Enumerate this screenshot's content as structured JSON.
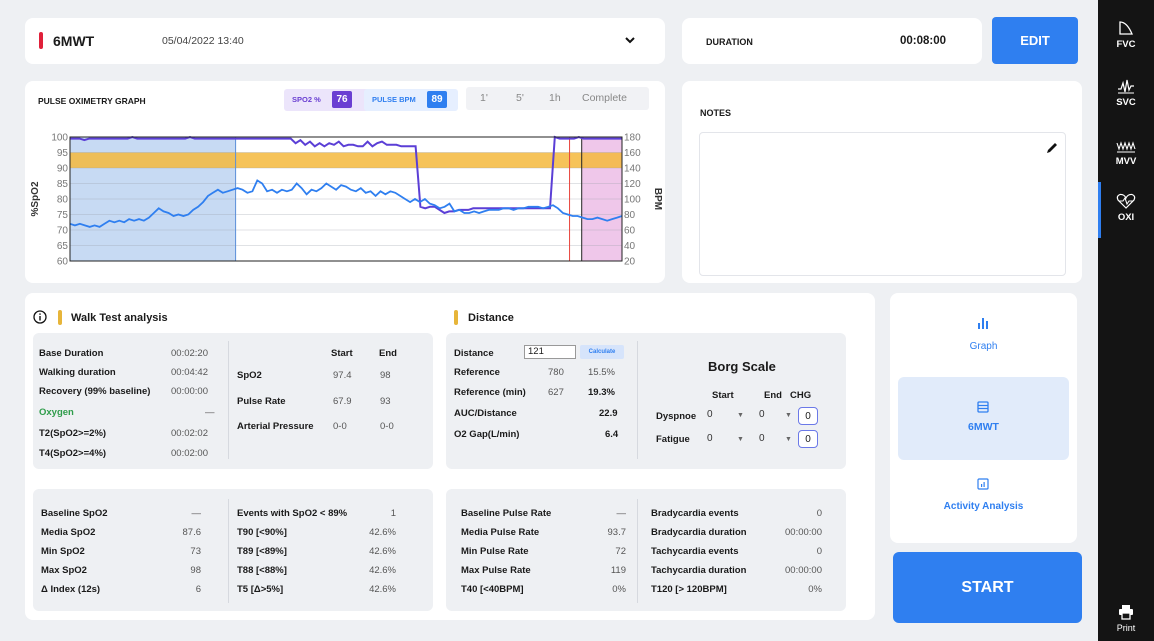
{
  "test": {
    "name": "6MWT",
    "datetime": "05/04/2022 13:40",
    "duration_label": "DURATION",
    "duration_value": "00:08:00",
    "edit_label": "EDIT"
  },
  "graph": {
    "title": "PULSE OXIMETRY GRAPH",
    "spo2_label": "SPO2 %",
    "spo2_value": "76",
    "pulse_label": "PULSE BPM",
    "pulse_value": "89",
    "ranges": [
      "1'",
      "5'",
      "1h",
      "Complete"
    ],
    "left_axis_label": "%SpO2",
    "right_axis_label": "BPM",
    "left_ticks": [
      "100",
      "95",
      "90",
      "85",
      "80",
      "75",
      "70",
      "65",
      "60"
    ],
    "right_ticks": [
      "180",
      "160",
      "140",
      "120",
      "100",
      "80",
      "60",
      "40",
      "20"
    ],
    "colors": {
      "spo2": "#5b3fd6",
      "pulse": "#2f7ff0",
      "band": "#f5b83c",
      "baseline": "#c4d8f2",
      "recovery": "#efc7ea"
    }
  },
  "chart_data": {
    "type": "line",
    "xlabel": "",
    "ylabel": "%SpO2",
    "y2label": "BPM",
    "ylim": [
      60,
      100
    ],
    "y2lim": [
      20,
      180
    ],
    "series": [
      {
        "axis": "left",
        "color": "#5b3fd6",
        "values": [
          99.5,
          99.5,
          99.5,
          99,
          99.5,
          99.5,
          99.5,
          99.5,
          99.5,
          99.5,
          99.5,
          99.5,
          99.5,
          100,
          99.5,
          99.5,
          99.5,
          99.5,
          99.5,
          99.5,
          99.5,
          99.5,
          99.5,
          99.5,
          99.5,
          100,
          99.5,
          99.5,
          99.5,
          99.5,
          99.5,
          99.5,
          99.5,
          99.5,
          99.5,
          99.5,
          99.5,
          99.5,
          99.5,
          99.5,
          99.5,
          99.5,
          99.5,
          99.5,
          99.5,
          99.5,
          99.5,
          98,
          99,
          97.5,
          98.5,
          97,
          98,
          97,
          98,
          97.5,
          98.5,
          97,
          97.5,
          97.5,
          97,
          97,
          98.5,
          97,
          98,
          98.5,
          97.5,
          97.5,
          97.5,
          97,
          97,
          97,
          97,
          77.5,
          77,
          77.5,
          77.5,
          76.5,
          75.5,
          76,
          76,
          76.5,
          76.5,
          76.5,
          77,
          77,
          77,
          77,
          77,
          77,
          77,
          77,
          77,
          77,
          77,
          77,
          77,
          77,
          77,
          77,
          77,
          100,
          99.5,
          99.5,
          99.5,
          99.5,
          100,
          99.5,
          99.5,
          99.5,
          99.5,
          99.5,
          99.5,
          99.5,
          99.5,
          99.5
        ]
      },
      {
        "axis": "right",
        "color": "#2f7ff0",
        "values": [
          68,
          66,
          68,
          66,
          64,
          66,
          64,
          68,
          72,
          70,
          72,
          70,
          74,
          72,
          74,
          72,
          76,
          82,
          88,
          84,
          82,
          78,
          80,
          78,
          80,
          86,
          90,
          96,
          104,
          108,
          112,
          108,
          110,
          112,
          114,
          112,
          108,
          110,
          124,
          120,
          110,
          112,
          108,
          112,
          110,
          112,
          120,
          114,
          106,
          112,
          110,
          114,
          120,
          116,
          112,
          118,
          116,
          112,
          110,
          114,
          108,
          110,
          104,
          110,
          106,
          110,
          108,
          104,
          100,
          96,
          100,
          96,
          100,
          94,
          92,
          88,
          90,
          94,
          84,
          86,
          82,
          82,
          84,
          82,
          84,
          86,
          86,
          86,
          88,
          88,
          86,
          88,
          88,
          90,
          90,
          90,
          88,
          90,
          92,
          88,
          82,
          80,
          78,
          78,
          76,
          74,
          74,
          76,
          74,
          72,
          74,
          76,
          78
        ]
      }
    ]
  },
  "notes": {
    "title": "NOTES"
  },
  "walk": {
    "title": "Walk Test analysis",
    "rows": [
      {
        "label": "Base Duration",
        "value": "00:02:20"
      },
      {
        "label": "Walking duration",
        "value": "00:04:42"
      },
      {
        "label": "Recovery (99% baseline)",
        "value": "00:00:00"
      },
      {
        "label": "Oxygen",
        "value": "—"
      },
      {
        "label": "T2(SpO2>=2%)",
        "value": "00:02:02"
      },
      {
        "label": "T4(SpO2>=4%)",
        "value": "00:02:00"
      }
    ],
    "start_label": "Start",
    "end_label": "End",
    "vitals": [
      {
        "label": "SpO2",
        "start": "97.4",
        "end": "98"
      },
      {
        "label": "Pulse Rate",
        "start": "67.9",
        "end": "93"
      },
      {
        "label": "Arterial Pressure",
        "start": "0-0",
        "end": "0-0"
      }
    ]
  },
  "distance": {
    "title": "Distance",
    "distance_label": "Distance",
    "distance_value": "121",
    "calculate_label": "Calculate",
    "rows": [
      {
        "label": "Reference",
        "value": "780",
        "pct": "15.5%"
      },
      {
        "label": "Reference (min)",
        "value": "627",
        "pct": "19.3%"
      },
      {
        "label": "AUC/Distance",
        "value": "",
        "pct": "22.9"
      },
      {
        "label": "O2 Gap(L/min)",
        "value": "",
        "pct": "6.4"
      }
    ]
  },
  "borg": {
    "title": "Borg Scale",
    "start_label": "Start",
    "end_label": "End",
    "chg_label": "CHG",
    "rows": [
      {
        "label": "Dyspnoe",
        "start": "0",
        "end": "0",
        "chg": "0"
      },
      {
        "label": "Fatigue",
        "start": "0",
        "end": "0",
        "chg": "0"
      }
    ]
  },
  "spo2_stats": [
    {
      "label": "Baseline SpO2",
      "value": "—"
    },
    {
      "label": "Media SpO2",
      "value": "87.6"
    },
    {
      "label": "Min SpO2",
      "value": "73"
    },
    {
      "label": "Max SpO2",
      "value": "98"
    },
    {
      "label": "Δ Index (12s)",
      "value": "6"
    }
  ],
  "spo2_events": [
    {
      "label": "Events with SpO2 < 89%",
      "value": "1"
    },
    {
      "label": "T90 [<90%]",
      "value": "42.6%"
    },
    {
      "label": "T89 [<89%]",
      "value": "42.6%"
    },
    {
      "label": "T88 [<88%]",
      "value": "42.6%"
    },
    {
      "label": "T5 [Δ>5%]",
      "value": "42.6%"
    }
  ],
  "pulse_stats": [
    {
      "label": "Baseline Pulse Rate",
      "value": "—"
    },
    {
      "label": "Media Pulse Rate",
      "value": "93.7"
    },
    {
      "label": "Min Pulse Rate",
      "value": "72"
    },
    {
      "label": "Max Pulse Rate",
      "value": "119"
    },
    {
      "label": "T40 [<40BPM]",
      "value": "0%"
    }
  ],
  "pulse_events": [
    {
      "label": "Bradycardia events",
      "value": "0"
    },
    {
      "label": "Bradycardia duration",
      "value": "00:00:00"
    },
    {
      "label": "Tachycardia events",
      "value": "0"
    },
    {
      "label": "Tachycardia duration",
      "value": "00:00:00"
    },
    {
      "label": "T120 [> 120BPM]",
      "value": "0%"
    }
  ],
  "views": [
    {
      "label": "Graph"
    },
    {
      "label": "6MWT"
    },
    {
      "label": "Activity Analysis"
    }
  ],
  "start_label": "START",
  "rail": [
    {
      "label": "FVC"
    },
    {
      "label": "SVC"
    },
    {
      "label": "MVV"
    },
    {
      "label": "OXI"
    }
  ],
  "print_label": "Print"
}
